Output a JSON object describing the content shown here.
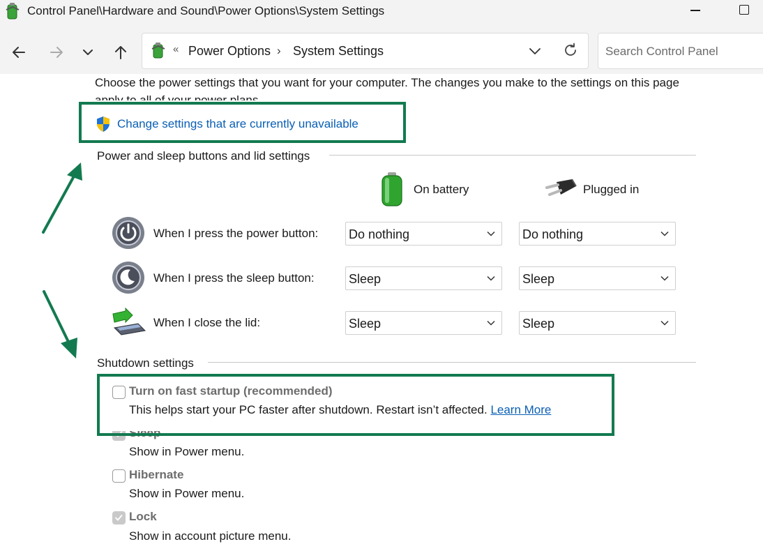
{
  "window": {
    "title": "Control Panel\\Hardware and Sound\\Power Options\\System Settings",
    "minimize_icon": "minimize-icon",
    "maximize_icon": "maximize-icon"
  },
  "nav": {
    "back_icon": "arrow-left-icon",
    "forward_icon": "arrow-right-icon",
    "recent_icon": "chevron-down-icon",
    "up_icon": "arrow-up-icon"
  },
  "address": {
    "separator": "«",
    "crumbs": [
      "Power Options",
      "System Settings"
    ],
    "chevron": "›"
  },
  "search": {
    "placeholder": "Search Control Panel"
  },
  "content": {
    "description": "Choose the power settings that you want for your computer. The changes you make to the settings on this page apply to all of your power plans.",
    "change_link": "Change settings that are currently unavailable"
  },
  "power_section": {
    "heading": "Power and sleep buttons and lid settings",
    "col_battery": "On battery",
    "col_plugged": "Plugged in",
    "rows": [
      {
        "label": "When I press the power button:",
        "battery": "Do nothing",
        "plugged": "Do nothing"
      },
      {
        "label": "When I press the sleep button:",
        "battery": "Sleep",
        "plugged": "Sleep"
      },
      {
        "label": "When I close the lid:",
        "battery": "Sleep",
        "plugged": "Sleep"
      }
    ]
  },
  "shutdown_section": {
    "heading": "Shutdown settings",
    "options": [
      {
        "title": "Turn on fast startup (recommended)",
        "desc": "This helps start your PC faster after shutdown. Restart isn’t affected.",
        "link": "Learn More",
        "checked": false
      },
      {
        "title": "Sleep",
        "desc": "Show in Power menu.",
        "checked": true
      },
      {
        "title": "Hibernate",
        "desc": "Show in Power menu.",
        "checked": false
      },
      {
        "title": "Lock",
        "desc": "Show in account picture menu.",
        "checked": true
      }
    ]
  },
  "annotation_color": "#137a50",
  "link_color": "#0a5fb4"
}
